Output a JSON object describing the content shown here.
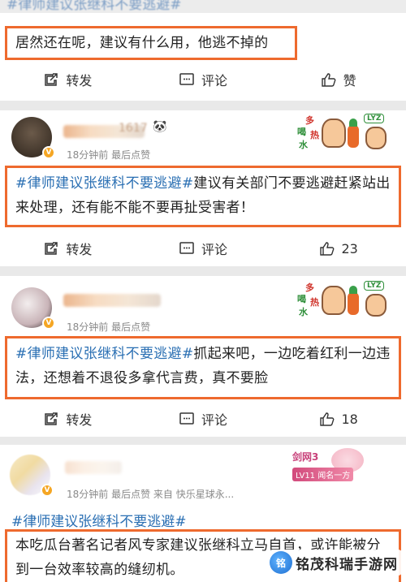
{
  "top_partial": "#律师建议张继科不要逃避#",
  "comments": [
    {
      "text_parts": [
        {
          "t": "居然还在呢，建议有什么用，他逃不掉的",
          "tag": false
        }
      ],
      "actions": {
        "repost": "转发",
        "comment": "评论",
        "like": "赞"
      }
    },
    {
      "name_partial": "1617",
      "meta": "18分钟前 最后点赞",
      "text_parts": [
        {
          "t": "#律师建议张继科不要逃避#",
          "tag": true
        },
        {
          "t": "建议有关部门不要逃避赶紧站出来处理，还有能不能不要再扯受害者！",
          "tag": false
        }
      ],
      "actions": {
        "repost": "转发",
        "comment": "评论",
        "like": "23"
      }
    },
    {
      "meta": "18分钟前 最后点赞",
      "text_parts": [
        {
          "t": "#律师建议张继科不要逃避#",
          "tag": true
        },
        {
          "t": "抓起来吧，一边吃着红利一边违法，还想着不退役多拿代言费，真不要脸",
          "tag": false
        }
      ],
      "actions": {
        "repost": "转发",
        "comment": "评论",
        "like": "18"
      }
    },
    {
      "meta": "18分钟前 最后点赞   来自 快乐星球永...",
      "badge_title": "剑网3",
      "badge_sub": "LV11 闻名一方",
      "hashtag": "#律师建议张继科不要逃避#",
      "text": "本吃瓜台著名记者风专家建议张继科立马自首，或许能被分到一台效率较高的缝纫机。"
    }
  ],
  "sticker": {
    "line1": "多",
    "line2": "喝",
    "line3": "热",
    "line4": "水",
    "tag": "LYZ"
  },
  "watermark": "铭茂科瑞手游网",
  "watermark_logo": "铭",
  "colors": {
    "highlight": "#ee6a2e",
    "hashtag": "#2a6fb3",
    "vip_badge": "#f5a623"
  },
  "icons": [
    "repost-icon",
    "comment-icon",
    "like-icon",
    "verified-badge-icon"
  ]
}
